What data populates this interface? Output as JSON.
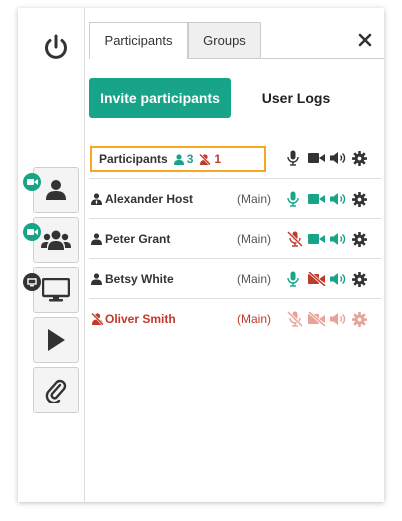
{
  "sidebar": {
    "power_icon": "power-icon",
    "buttons": [
      {
        "icon": "user-icon",
        "badge": "video-camera-icon",
        "badge_color": "#17a488"
      },
      {
        "icon": "users-icon",
        "badge": "video-camera-icon",
        "badge_color": "#17a488"
      },
      {
        "icon": "monitor-icon",
        "badge": "screen-share-icon",
        "badge_color": "#333333"
      },
      {
        "icon": "play-icon"
      },
      {
        "icon": "paperclip-icon"
      }
    ]
  },
  "tabs": [
    {
      "label": "Participants",
      "active": true
    },
    {
      "label": "Groups",
      "active": false
    }
  ],
  "actions": {
    "invite_label": "Invite participants",
    "user_logs_label": "User Logs"
  },
  "header": {
    "title": "Participants",
    "online_count": "3",
    "offline_count": "1"
  },
  "participants": [
    {
      "name": "Alexander Host",
      "room": "(Main)",
      "role_icon": "host-user-icon",
      "mic": "on",
      "camera": "on",
      "speaker": "on",
      "status": "online"
    },
    {
      "name": "Peter Grant",
      "room": "(Main)",
      "role_icon": "user-icon",
      "mic": "muted",
      "camera": "on",
      "speaker": "on",
      "status": "online"
    },
    {
      "name": "Betsy White",
      "room": "(Main)",
      "role_icon": "user-icon",
      "mic": "on",
      "camera": "off",
      "speaker": "on",
      "status": "online"
    },
    {
      "name": "Oliver Smith",
      "room": "(Main)",
      "role_icon": "user-slash-icon",
      "mic": "muted",
      "camera": "off",
      "speaker": "on",
      "status": "offline"
    }
  ],
  "colors": {
    "accent": "#17a488",
    "danger": "#c0392b",
    "faded_danger": "#e8a29a",
    "highlight": "#f5a623"
  }
}
